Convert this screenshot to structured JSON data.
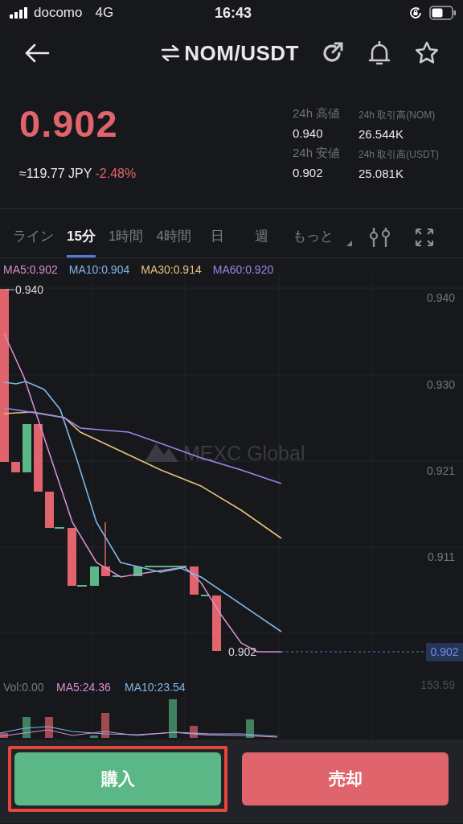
{
  "status_bar": {
    "carrier": "docomo",
    "network": "4G",
    "time": "16:43"
  },
  "header": {
    "title": "NOM/USDT"
  },
  "ticker": {
    "price": "0.902",
    "fiat": "≈119.77 JPY",
    "change": "-2.48%",
    "stats": [
      {
        "label": "24h 高値",
        "value": "0.940"
      },
      {
        "label": "24h 取引高(NOM)",
        "value": "26.544K"
      },
      {
        "label": "24h 安値",
        "value": "0.902"
      },
      {
        "label": "24h 取引高(USDT)",
        "value": "25.081K"
      }
    ]
  },
  "chart_tabs": [
    {
      "label": "ライン",
      "selected": false
    },
    {
      "label": "15分",
      "selected": true
    },
    {
      "label": "1時間",
      "selected": false
    },
    {
      "label": "4時間",
      "selected": false
    },
    {
      "label": "日",
      "selected": false
    },
    {
      "label": "週",
      "selected": false
    },
    {
      "label": "もっと",
      "selected": false
    }
  ],
  "chart": {
    "ma_legend": [
      {
        "label": "MA5:0.902",
        "color": "#d48fd0"
      },
      {
        "label": "MA10:0.904",
        "color": "#7fb6e6"
      },
      {
        "label": "MA30:0.914",
        "color": "#e5c27a"
      },
      {
        "label": "MA60:0.920",
        "color": "#9a86e8"
      }
    ],
    "watermark": "MEXC Global",
    "y_axis_labels": [
      "0.940",
      "0.930",
      "0.921",
      "0.911"
    ],
    "high_label": "0.940",
    "low_label": "0.902",
    "last_price": "0.902"
  },
  "volume": {
    "legend": [
      {
        "label": "Vol:0.00",
        "color": "#7a7c82"
      },
      {
        "label": "MA5:24.36",
        "color": "#d48fd0"
      },
      {
        "label": "MA10:23.54",
        "color": "#7fb6e6"
      }
    ],
    "max_label": "153.59"
  },
  "actions": [
    {
      "label": "購入",
      "kind": "buy",
      "highlighted": true
    },
    {
      "label": "売却",
      "kind": "sell",
      "highlighted": false
    }
  ]
}
